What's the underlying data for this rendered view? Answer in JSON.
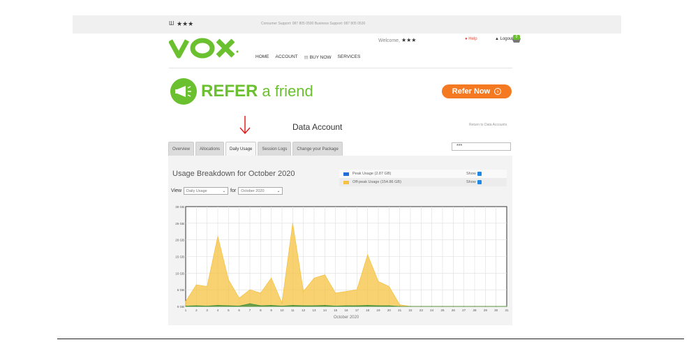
{
  "topbar": {
    "icon": "Ш",
    "masked": "★★★",
    "support": "Consumer Support: 087 805 0500 Business Support: 087 805 0530"
  },
  "header": {
    "welcome": "Welcome,",
    "welcome_masked": "★★★",
    "help": "Help",
    "logout": "Logout",
    "cart_count": "0",
    "nav": [
      "HOME",
      "ACCOUNT",
      "BUY NOW",
      "SERVICES"
    ]
  },
  "banner": {
    "refer_title": "REFER",
    "refer_sub": "a friend",
    "refer_button": "Refer Now"
  },
  "page": {
    "title": "Data Account",
    "return_link": "Return to Data Accounts",
    "tabs": [
      "Overview",
      "Allocations",
      "Daily Usage",
      "Session Logs",
      "Change your Package"
    ],
    "active_tab": 2,
    "account_value": "***"
  },
  "usage": {
    "title": "Usage Breakdown for October 2020",
    "view_label": "View",
    "view_value": "Daily Usage",
    "for_label": "for",
    "month_value": "October 2020",
    "legend": [
      {
        "label": "Peak Usage (2.87 GB)",
        "color": "#1e6fd9",
        "show": "Show"
      },
      {
        "label": "Off-peak Usage (154.86 GB)",
        "color": "#f5c242",
        "show": "Show"
      }
    ]
  },
  "chart_data": {
    "type": "area",
    "xlabel": "October 2020",
    "x": [
      1,
      2,
      3,
      4,
      5,
      6,
      7,
      8,
      9,
      10,
      11,
      12,
      13,
      14,
      15,
      16,
      17,
      18,
      19,
      20,
      21,
      22,
      23,
      24,
      25,
      26,
      27,
      28,
      29,
      30,
      31
    ],
    "yticks": [
      "0 GB",
      "5 GB",
      "10 GB",
      "15 GB",
      "20 GB",
      "25 GB",
      "30 GB"
    ],
    "ylim": [
      0,
      30
    ],
    "series": [
      {
        "name": "Off-peak Usage",
        "color": "#f5c242",
        "values": [
          1.5,
          6.5,
          6,
          21,
          8,
          2.5,
          5,
          4,
          8.5,
          1,
          25,
          4.5,
          8.5,
          9.5,
          4,
          4.5,
          5,
          15.5,
          7.5,
          6,
          0.5,
          0,
          0,
          0,
          0,
          0,
          0,
          0,
          0,
          0,
          0
        ]
      },
      {
        "name": "Peak Usage",
        "color": "#3b8e3b",
        "values": [
          0.1,
          0.2,
          0.1,
          0.3,
          0.2,
          0.1,
          0.8,
          0.2,
          0.3,
          0.1,
          0.3,
          0.2,
          0.2,
          0.3,
          0.1,
          0.2,
          0.2,
          0.3,
          0.2,
          0.2,
          0,
          0,
          0,
          0,
          0,
          0,
          0,
          0,
          0,
          0,
          0
        ]
      }
    ]
  }
}
